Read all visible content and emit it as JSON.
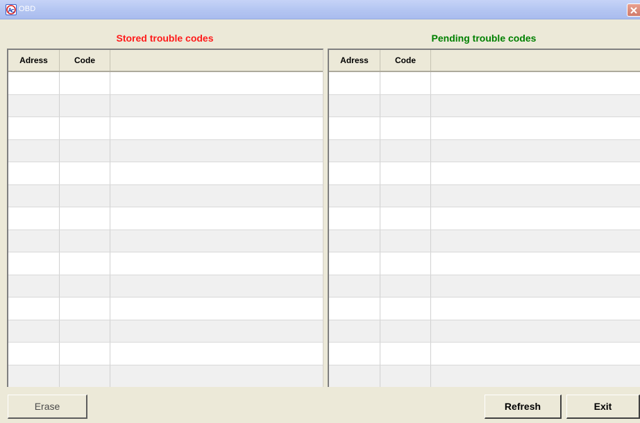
{
  "window": {
    "title": "OBD",
    "app_icon": "ac-logo-icon",
    "close_icon": "close-icon"
  },
  "stored": {
    "title": "Stored trouble codes",
    "color": "#ff1a1a",
    "columns": [
      "Adress",
      "Code",
      ""
    ],
    "rows": 14
  },
  "pending": {
    "title": "Pending trouble codes",
    "color": "#008000",
    "columns": [
      "Adress",
      "Code",
      ""
    ],
    "rows": 14
  },
  "buttons": {
    "erase": "Erase",
    "refresh": "Refresh",
    "exit": "Exit"
  }
}
